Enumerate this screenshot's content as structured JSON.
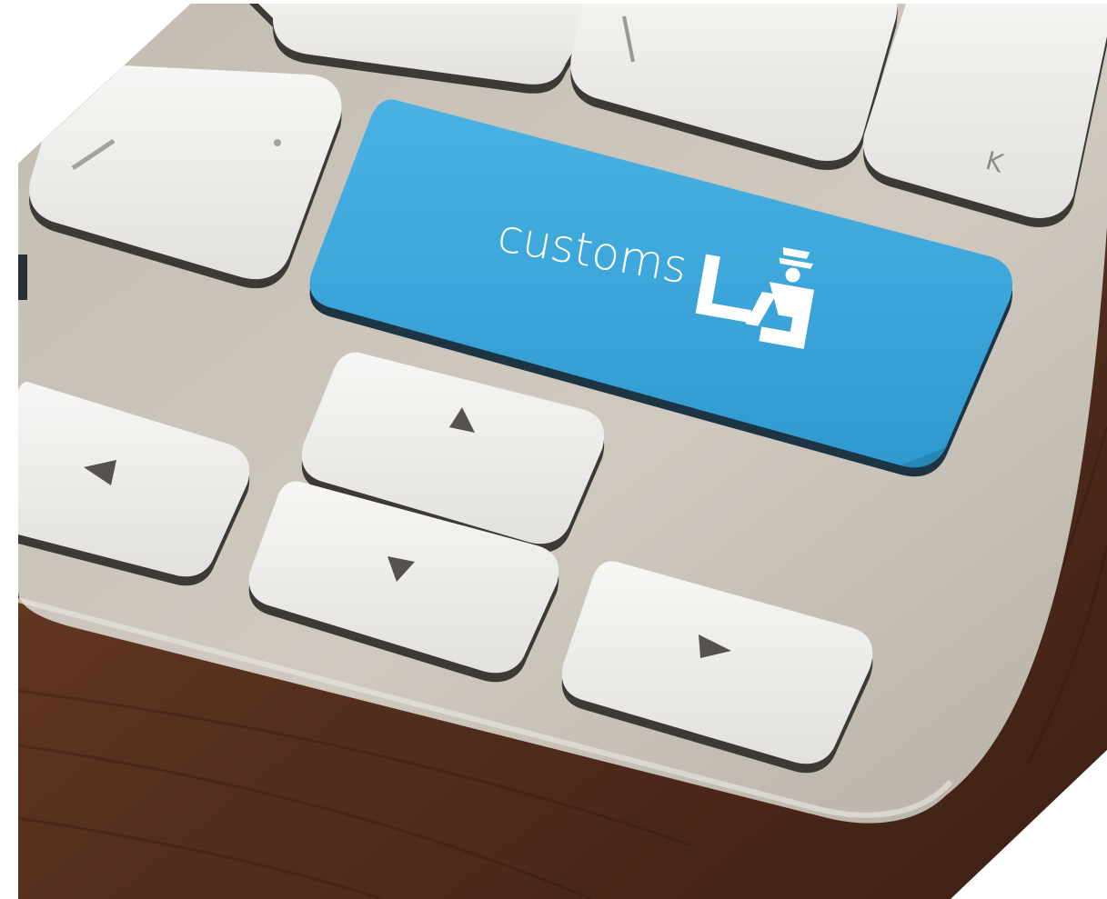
{
  "customs_key": {
    "label": "customs",
    "icon": "customs-officer-icon"
  },
  "arrow_keys": {
    "up": "triangle-up-glyph",
    "down": "triangle-down-glyph",
    "left": "triangle-left-glyph",
    "right": "triangle-right-glyph"
  },
  "colors": {
    "accent_key": "#35a4dc",
    "key_face": "#eeeeec",
    "keyboard_body": "#c9c3b9",
    "desk_wood": "#5a2f1d"
  }
}
